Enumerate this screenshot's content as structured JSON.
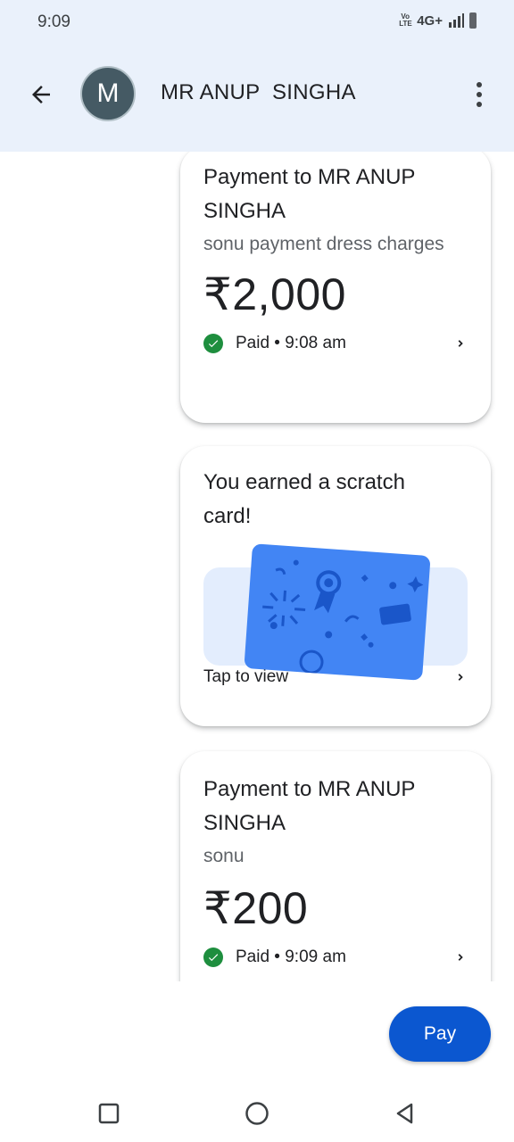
{
  "status_bar": {
    "time": "9:09",
    "volte": "Vo LTE",
    "network": "4G+"
  },
  "header": {
    "avatar_letter": "M",
    "contact_name": "MR ANUP  SINGHA",
    "back_icon": "arrow-back-icon",
    "more_icon": "more-vert-icon"
  },
  "messages": [
    {
      "title": "Payment to MR ANUP SINGHA",
      "note": "sonu payment dress charges",
      "amount": "₹2,000",
      "status": "Paid • 9:08 am"
    },
    {
      "title": "You earned a scratch card!",
      "action": "Tap to view"
    },
    {
      "title": "Payment to MR ANUP SINGHA",
      "note": "sonu",
      "amount": "₹200",
      "status": "Paid • 9:09 am"
    }
  ],
  "fab": {
    "label": "Pay"
  },
  "colors": {
    "header_bg": "#eaf1fb",
    "paid_green": "#1e8e3e",
    "pay_button": "#0b57d0",
    "scratch_card": "#4285f4"
  }
}
